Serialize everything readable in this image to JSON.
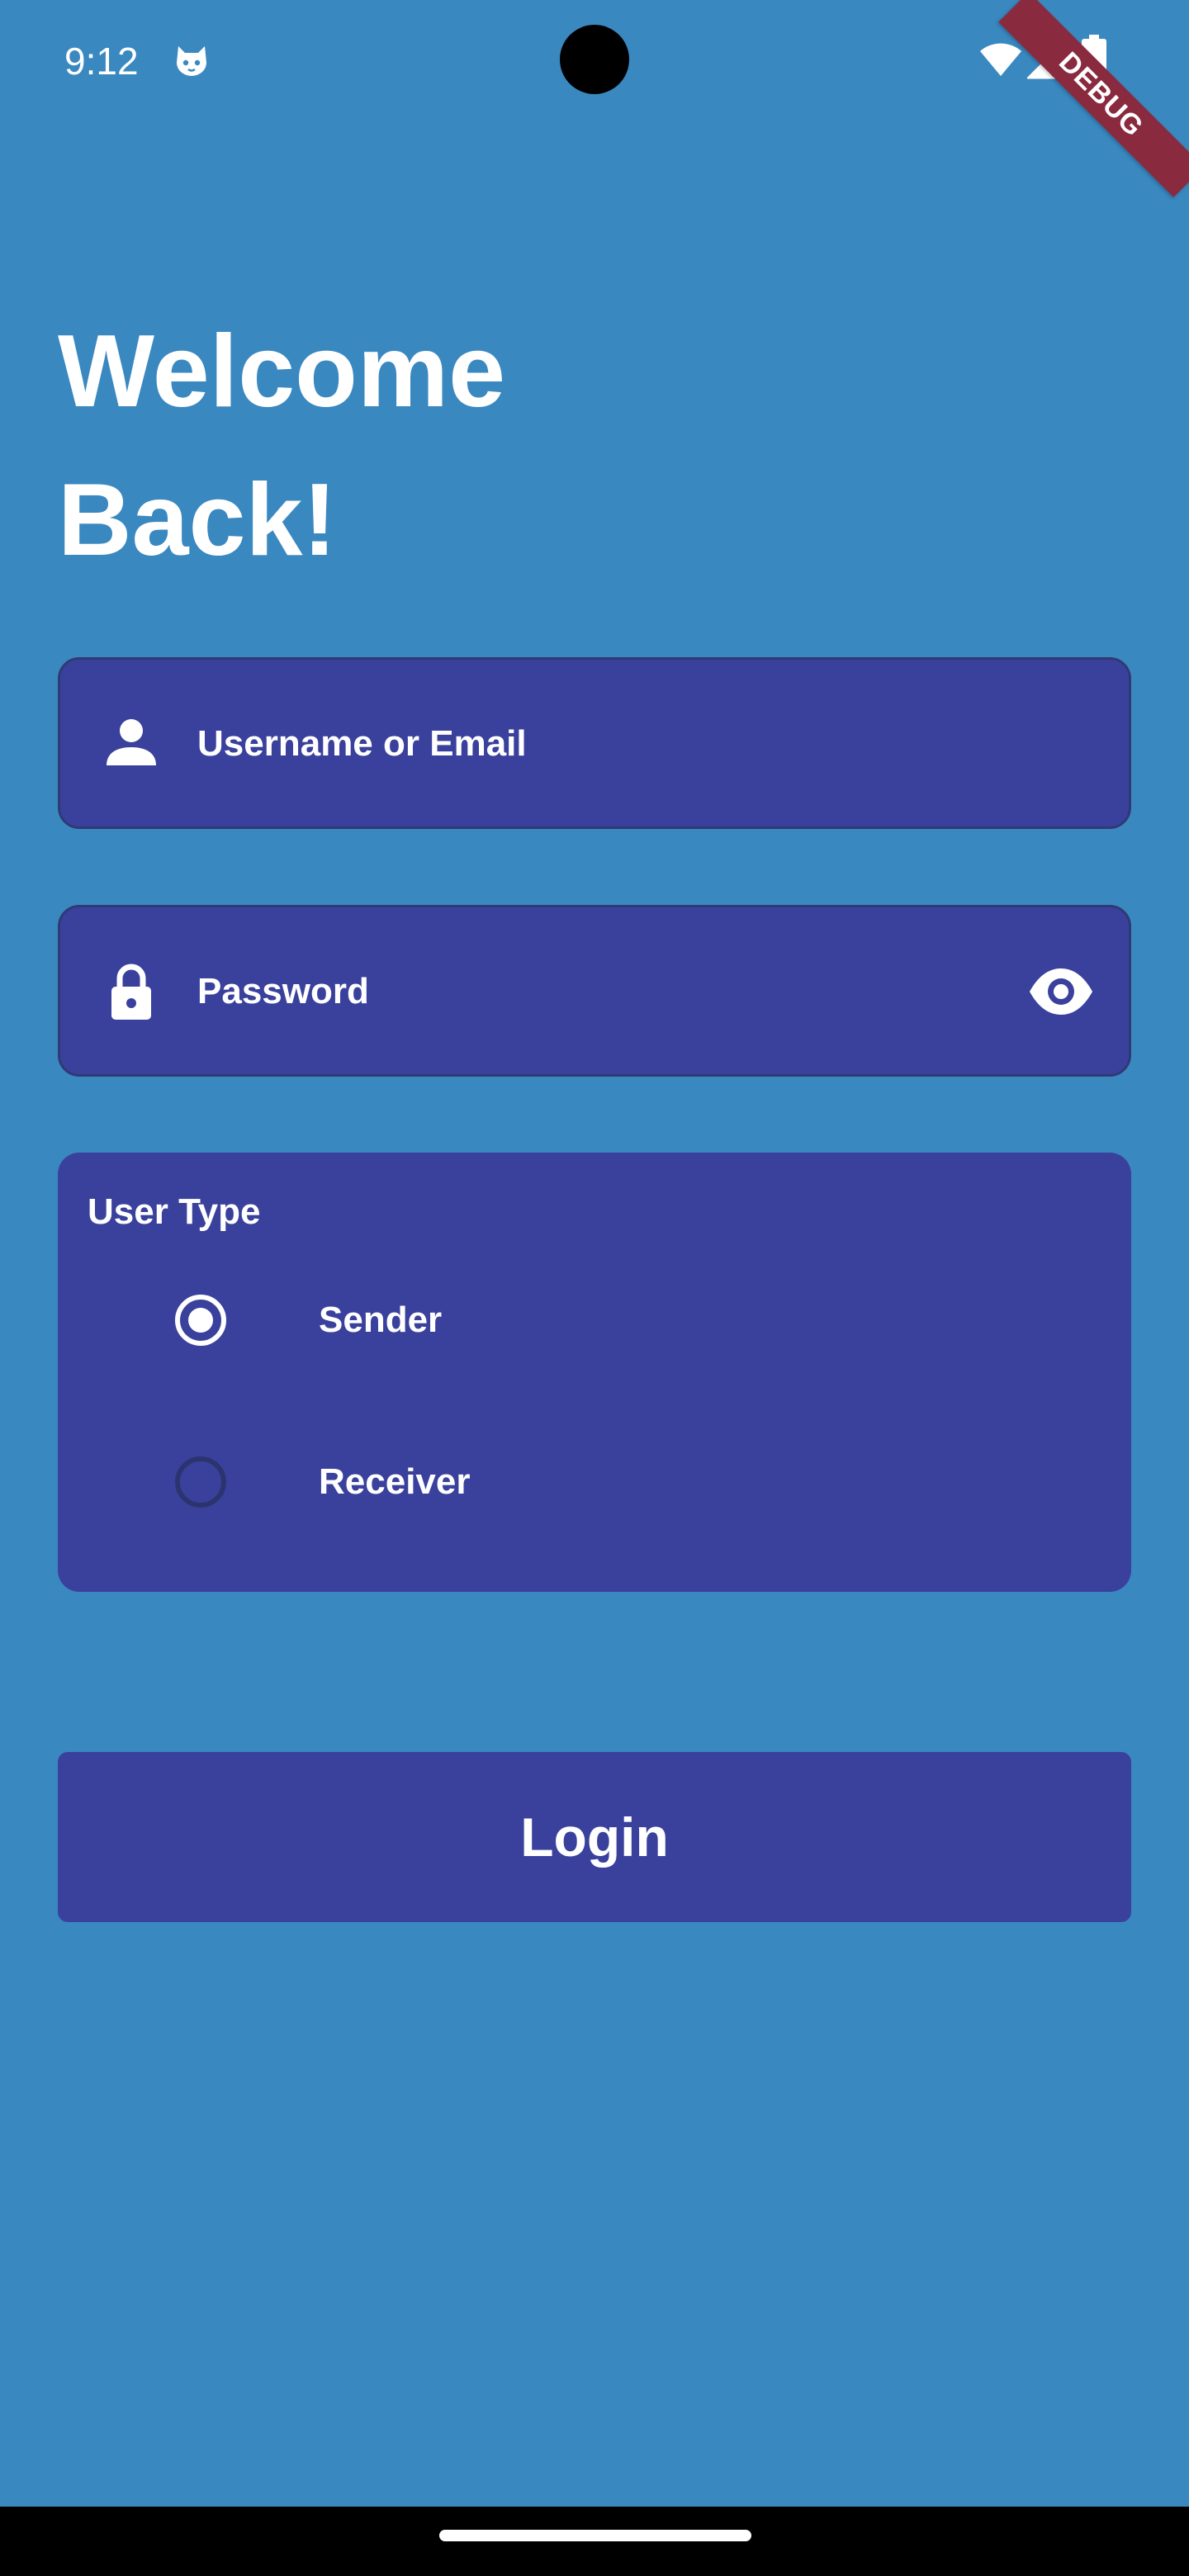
{
  "status_bar": {
    "time": "9:12",
    "app_icon": "cat-face-icon",
    "wifi_icon": "wifi-icon",
    "signal_icon": "cell-signal-icon",
    "battery_icon": "battery-icon"
  },
  "debug_banner": {
    "label": "DEBUG",
    "color": "#8a2a3e"
  },
  "header": {
    "title": "Welcome\nBack!"
  },
  "login_form": {
    "username": {
      "placeholder": "Username or Email",
      "value": "",
      "icon": "person-icon"
    },
    "password": {
      "placeholder": "Password",
      "value": "",
      "icon": "lock-icon",
      "toggle_icon": "eye-icon"
    },
    "user_type": {
      "label": "User Type",
      "options": [
        {
          "label": "Sender",
          "selected": true
        },
        {
          "label": "Receiver",
          "selected": false
        }
      ]
    },
    "login_label": "Login"
  },
  "colors": {
    "background": "#3a88c0",
    "field_fill": "#3a419d",
    "field_border": "#2f3a74",
    "text": "#ffffff"
  }
}
